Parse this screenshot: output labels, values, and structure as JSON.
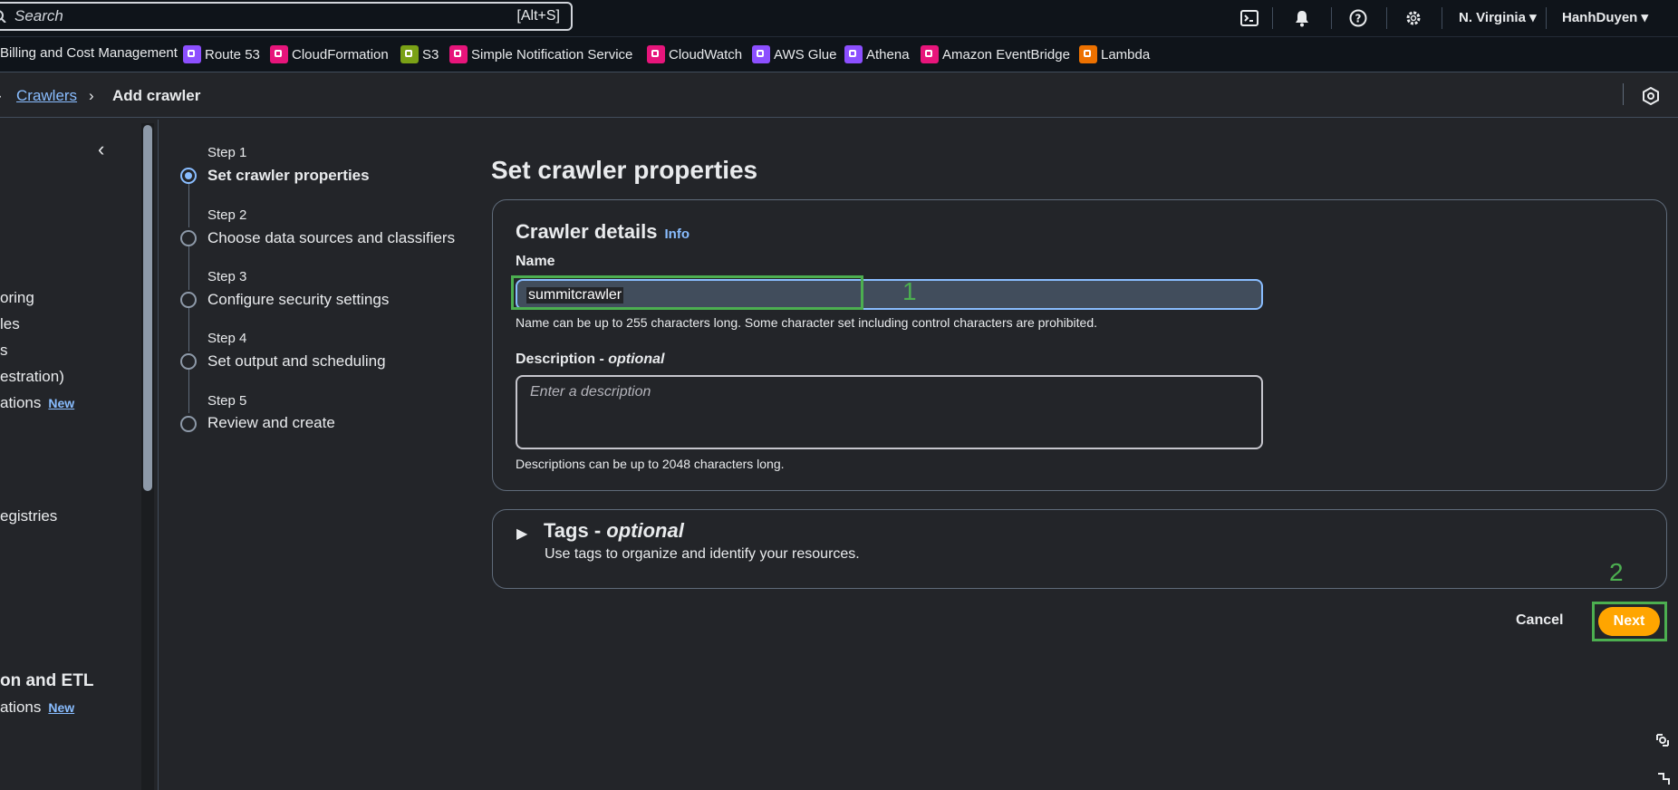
{
  "topbar": {
    "search_placeholder": "Search",
    "search_shortcut": "[Alt+S]",
    "region": "N. Virginia ▾",
    "user": "HanhDuyen ▾"
  },
  "favorites": [
    {
      "label": "Billing and Cost Management",
      "color": "#0f141a"
    },
    {
      "label": "Route 53",
      "color": "#8c4fff"
    },
    {
      "label": "CloudFormation",
      "color": "#e7157b"
    },
    {
      "label": "S3",
      "color": "#7aa116"
    },
    {
      "label": "Simple Notification Service",
      "color": "#e7157b"
    },
    {
      "label": "CloudWatch",
      "color": "#e7157b"
    },
    {
      "label": "AWS Glue",
      "color": "#8c4fff"
    },
    {
      "label": "Athena",
      "color": "#8c4fff"
    },
    {
      "label": "Amazon EventBridge",
      "color": "#e7157b"
    },
    {
      "label": "Lambda",
      "color": "#ed7100"
    }
  ],
  "breadcrumb": {
    "link": "Crawlers",
    "current": "Add crawler"
  },
  "sidenav": {
    "items": [
      "oring",
      "les",
      "s",
      "estration)",
      "ations",
      "egistries",
      "ations"
    ],
    "new_badge": "New",
    "heading": "on and ETL"
  },
  "steps": [
    {
      "num": "Step 1",
      "label": "Set crawler properties"
    },
    {
      "num": "Step 2",
      "label": "Choose data sources and classifiers"
    },
    {
      "num": "Step 3",
      "label": "Configure security settings"
    },
    {
      "num": "Step 4",
      "label": "Set output and scheduling"
    },
    {
      "num": "Step 5",
      "label": "Review and create"
    }
  ],
  "main": {
    "title": "Set crawler properties",
    "details": {
      "title": "Crawler details",
      "info": "Info",
      "name_label": "Name",
      "name_value": "summitcrawler",
      "name_hint": "Name can be up to 255 characters long. Some character set including control characters are prohibited.",
      "desc_label": "Description - ",
      "desc_optional": "optional",
      "desc_placeholder": "Enter a description",
      "desc_hint": "Descriptions can be up to 2048 characters long."
    },
    "tags": {
      "title": "Tags - ",
      "optional": "optional",
      "description": "Use tags to organize and identify your resources."
    },
    "cancel": "Cancel",
    "next": "Next"
  },
  "annotations": {
    "one": "1",
    "two": "2"
  },
  "colors": {
    "accent": "#89bdff",
    "primary_button": "#ffa500",
    "highlight": "#4caf50",
    "background": "#232529",
    "topbar": "#0f141a"
  }
}
